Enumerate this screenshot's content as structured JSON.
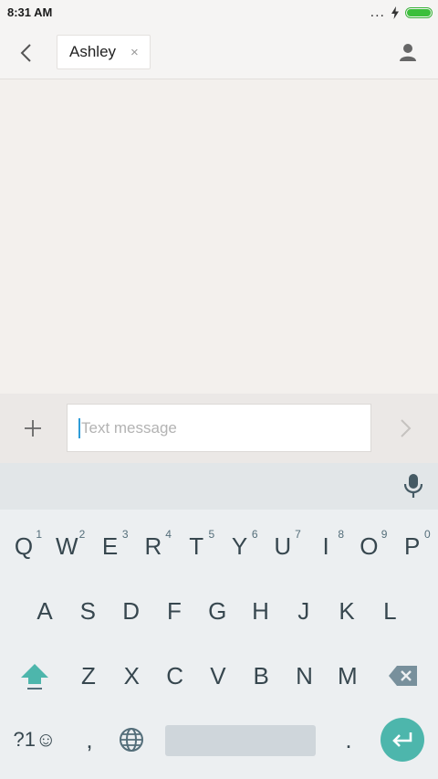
{
  "status_bar": {
    "time": "8:31 AM",
    "more": "..."
  },
  "header": {
    "recipient": "Ashley",
    "remove_glyph": "×"
  },
  "compose": {
    "placeholder": "Text message"
  },
  "keyboard": {
    "rows": [
      [
        {
          "label": "Q",
          "hint": "1"
        },
        {
          "label": "W",
          "hint": "2"
        },
        {
          "label": "E",
          "hint": "3"
        },
        {
          "label": "R",
          "hint": "4"
        },
        {
          "label": "T",
          "hint": "5"
        },
        {
          "label": "Y",
          "hint": "6"
        },
        {
          "label": "U",
          "hint": "7"
        },
        {
          "label": "I",
          "hint": "8"
        },
        {
          "label": "O",
          "hint": "9"
        },
        {
          "label": "P",
          "hint": "0"
        }
      ],
      [
        {
          "label": "A"
        },
        {
          "label": "S"
        },
        {
          "label": "D"
        },
        {
          "label": "F"
        },
        {
          "label": "G"
        },
        {
          "label": "H"
        },
        {
          "label": "J"
        },
        {
          "label": "K"
        },
        {
          "label": "L"
        }
      ],
      [
        {
          "label": "Z"
        },
        {
          "label": "X"
        },
        {
          "label": "C"
        },
        {
          "label": "V"
        },
        {
          "label": "B"
        },
        {
          "label": "N"
        },
        {
          "label": "M"
        }
      ]
    ],
    "symbols_label": "?1☺",
    "comma_label": ",",
    "period_label": "."
  },
  "colors": {
    "enter_key": "#4db6ac",
    "shift_icon": "#4db6ac",
    "caret": "#2f9cd8",
    "battery": "#3bbf3b"
  },
  "icons": [
    "back-arrow-icon",
    "close-icon",
    "contact-icon",
    "plus-icon",
    "send-arrow-icon",
    "mic-icon",
    "shift-icon",
    "backspace-icon",
    "globe-icon",
    "enter-icon",
    "bolt-icon",
    "battery-icon"
  ]
}
